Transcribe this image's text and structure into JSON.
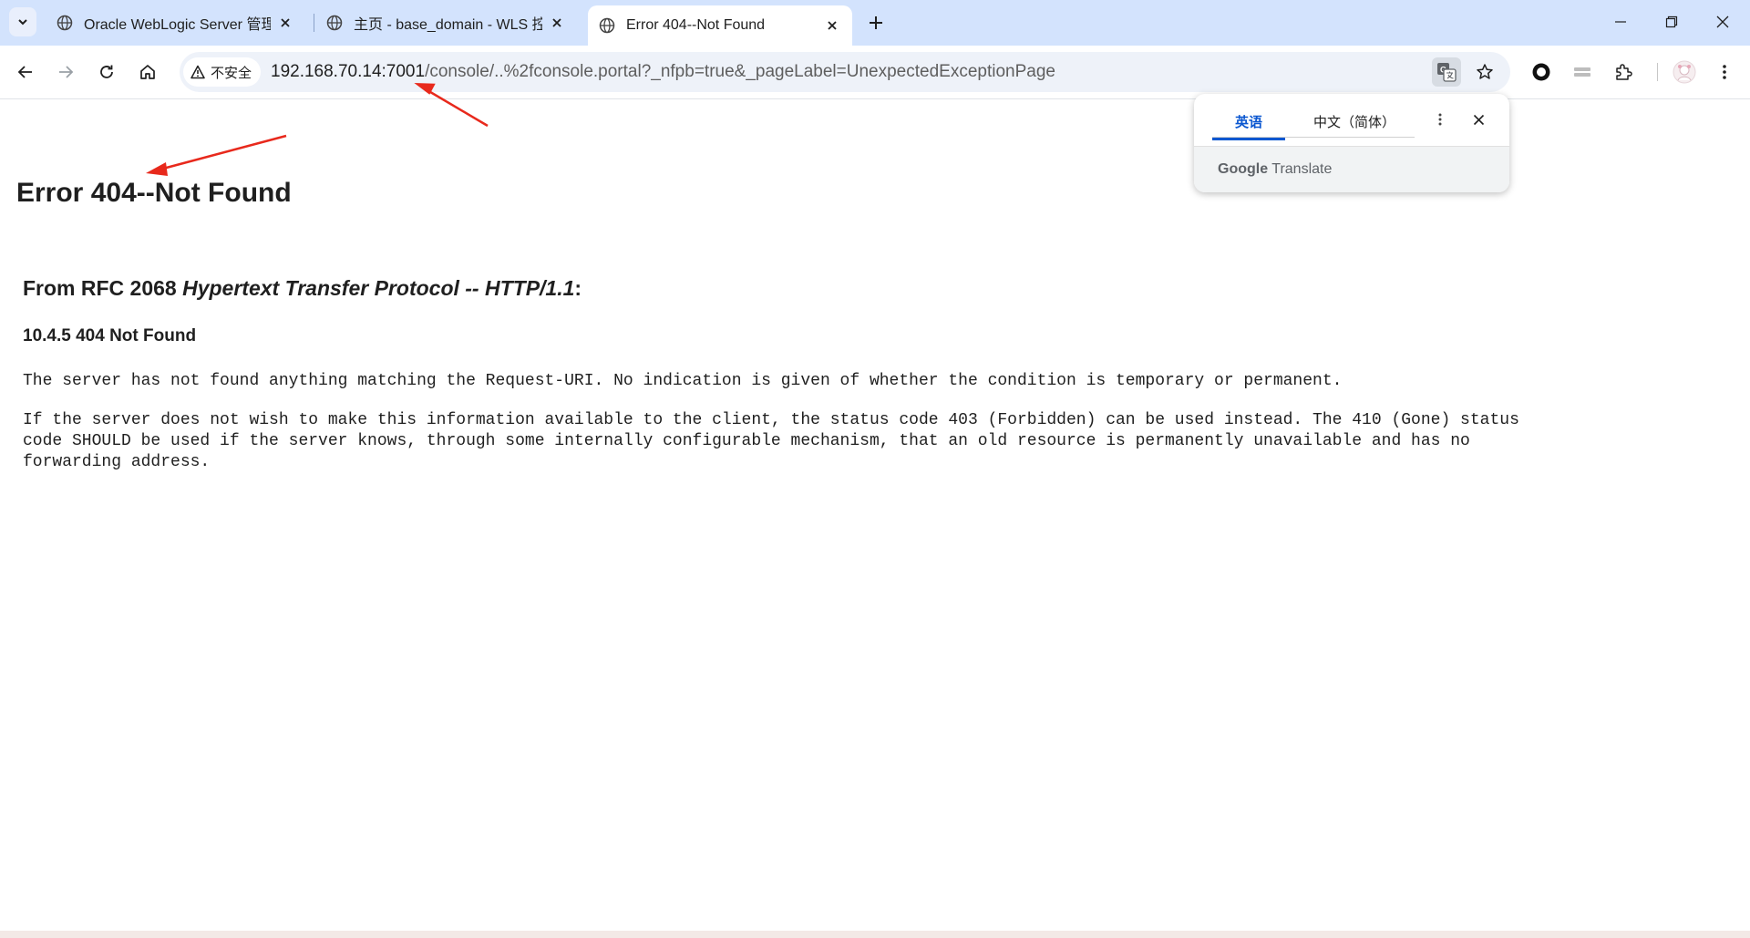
{
  "tabs": [
    {
      "title": "Oracle WebLogic Server 管理",
      "active": false
    },
    {
      "title": "主页 - base_domain - WLS 控",
      "active": false
    },
    {
      "title": "Error 404--Not Found",
      "active": true
    }
  ],
  "toolbar": {
    "security_label": "不安全",
    "url_host": "192.168.70.14:7001",
    "url_path": "/console/..%2fconsole.portal?_nfpb=true&_pageLabel=UnexpectedExceptionPage"
  },
  "translate_popup": {
    "source_lang": "英语",
    "target_lang": "中文（简体）",
    "brand_google": "Google",
    "brand_translate": "Translate"
  },
  "page": {
    "heading": "Error 404--Not Found",
    "rfc_prefix": "From RFC 2068 ",
    "rfc_title": "Hypertext Transfer Protocol -- HTTP/1.1",
    "rfc_suffix": ":",
    "section": "10.4.5 404 Not Found",
    "para1": "The server has not found anything matching the Request-URI. No indication is given of whether the condition is temporary or permanent.",
    "para2_line1": "If the server does not wish to make this information available to the client, the status code 403 (Forbidden) can be used instead. The 410 (Gone) status",
    "para2_line2": "code SHOULD be used if the server knows, through some internally configurable mechanism, that an old resource is permanently unavailable and has no",
    "para2_line3": "forwarding address."
  },
  "colors": {
    "tabstrip": "#d3e3fd",
    "accent": "#0b57d0",
    "annotation_arrow": "#e8291c"
  }
}
